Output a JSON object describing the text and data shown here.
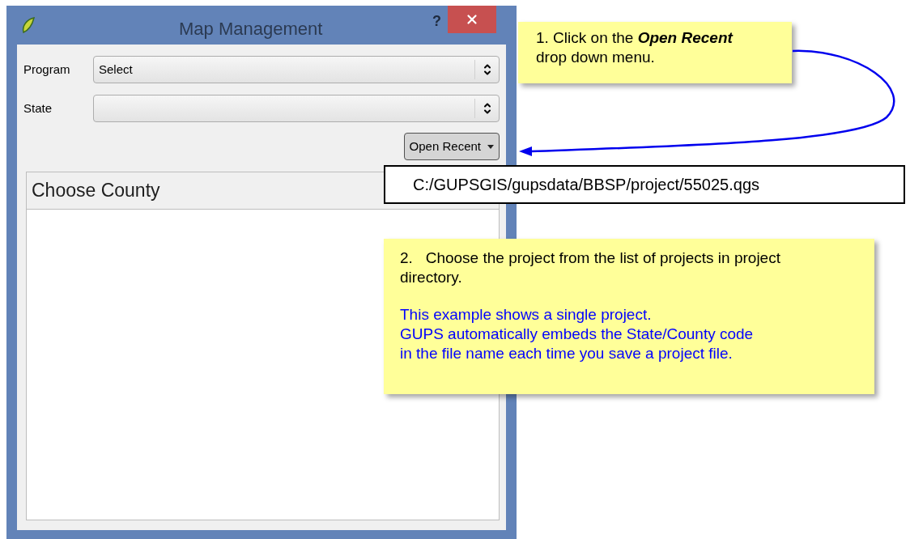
{
  "window": {
    "title": "Map Management",
    "help": "?"
  },
  "fields": [
    {
      "label": "Program",
      "value": "Select"
    },
    {
      "label": "State"
    }
  ],
  "open_recent": {
    "label": "Open Recent",
    "pressed": true
  },
  "recent_menu": [
    {
      "label": "C:/GUPSGIS/gupsdata/BBSP/project/55025.qgs",
      "selected": false
    }
  ],
  "county_panel": {
    "title": "Choose County"
  },
  "callouts": [
    {
      "lines": [
        "1. Click on the **Open Recent** drop down menu."
      ]
    },
    {
      "lines": [
        "2.   Choose the project from the list of projects in project directory."
      ],
      "note_lines": [
        "This example shows a single project.",
        "GUPS automatically embeds the State/County code",
        "in the file name each time you save a project file."
      ]
    }
  ]
}
